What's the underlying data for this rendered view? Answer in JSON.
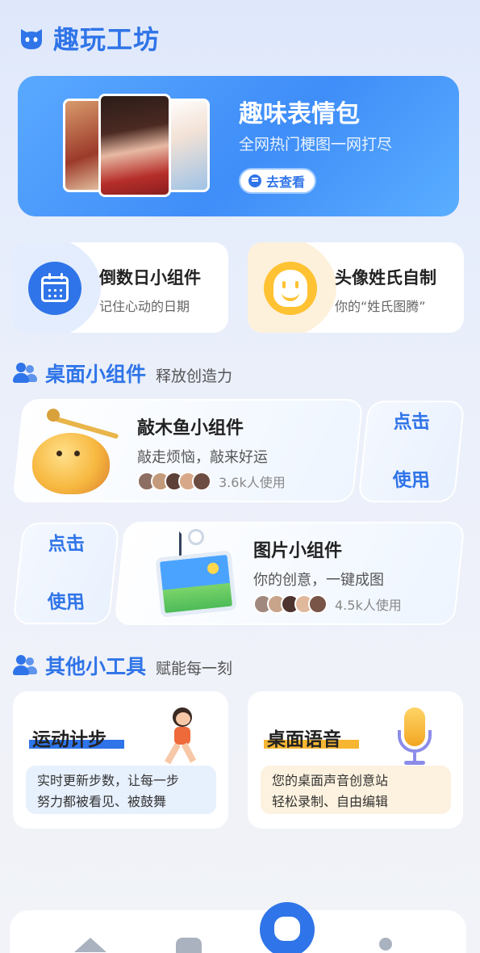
{
  "app": {
    "title": "趣玩工坊",
    "logo_icon": "cat-face-icon",
    "accent_color": "#2f74e8"
  },
  "banner": {
    "title": "趣味表情包",
    "subtitle": "全网热门梗图一网打尽",
    "button_label": "去查看",
    "button_icon": "chat-bubble-icon"
  },
  "features": [
    {
      "title": "倒数日小组件",
      "subtitle": "记住心动的日期",
      "icon": "calendar-icon"
    },
    {
      "title": "头像姓氏自制",
      "subtitle": "你的“姓氏图腾”",
      "icon": "smile-face-icon"
    }
  ],
  "desktop_section": {
    "title": "桌面小组件",
    "subtitle": "释放创造力",
    "icon": "users-icon"
  },
  "widgets": [
    {
      "title": "敲木鱼小组件",
      "subtitle": "敲走烦恼，敲来好运",
      "users": "3.6k人使用",
      "button": [
        "点击",
        "使用"
      ]
    },
    {
      "title": "图片小组件",
      "subtitle": "你的创意，一键成图",
      "users": "4.5k人使用",
      "button": [
        "点击",
        "使用"
      ]
    }
  ],
  "tools_section": {
    "title": "其他小工具",
    "subtitle": "赋能每一刻",
    "icon": "users-icon"
  },
  "tools": [
    {
      "title": "运动计步",
      "desc_line1": "实时更新步数，让每一步",
      "desc_line2": "努力都被看见、被鼓舞",
      "illustration": "runner-icon"
    },
    {
      "title": "桌面语音",
      "desc_line1": "您的桌面声音创意站",
      "desc_line2": "轻松录制、自由编辑",
      "illustration": "microphone-icon"
    }
  ],
  "bottom_nav": [
    "home-icon",
    "box-icon",
    "center-face-icon",
    "user-icon"
  ]
}
